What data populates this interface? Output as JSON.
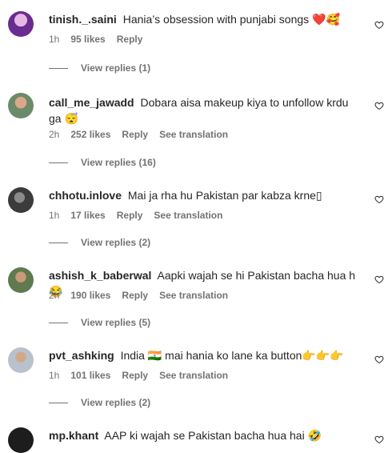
{
  "comments": [
    {
      "username": "tinish._.saini",
      "text": "Hania’s obsession with punjabi songs ❤️🥰",
      "time": "1h",
      "likes": "95 likes",
      "reply": "Reply",
      "translation": "",
      "view_replies": "View replies (1)"
    },
    {
      "username": "call_me_jawadd",
      "text": "Dobara aisa makeup kiya to unfollow krdu ga 😴",
      "time": "2h",
      "likes": "252 likes",
      "reply": "Reply",
      "translation": "See translation",
      "view_replies": "View replies (16)"
    },
    {
      "username": "chhotu.inlove",
      "text": "Mai ja rha hu Pakistan par kabza krne▯",
      "time": "1h",
      "likes": "17 likes",
      "reply": "Reply",
      "translation": "See translation",
      "view_replies": "View replies (2)"
    },
    {
      "username": "ashish_k_baberwal",
      "text": "Aapki wajah se hi Pakistan bacha hua h😂",
      "time": "2h",
      "likes": "190 likes",
      "reply": "Reply",
      "translation": "See translation",
      "view_replies": "View replies (5)"
    },
    {
      "username": "pvt_ashking",
      "text": "India 🇮🇳 mai hania ko lane ka button👉👉👉",
      "time": "1h",
      "likes": "101 likes",
      "reply": "Reply",
      "translation": "See translation",
      "view_replies": "View replies (2)"
    },
    {
      "username": "mp.khant",
      "text": "AAP ki wajah se Pakistan bacha hua hai 🤣",
      "time": "",
      "likes": "",
      "reply": "",
      "translation": "",
      "view_replies": ""
    }
  ],
  "icons": {
    "like": "heart-outline-icon"
  },
  "colors": {
    "text": "#262626",
    "muted": "#737373",
    "background": "#ffffff"
  }
}
